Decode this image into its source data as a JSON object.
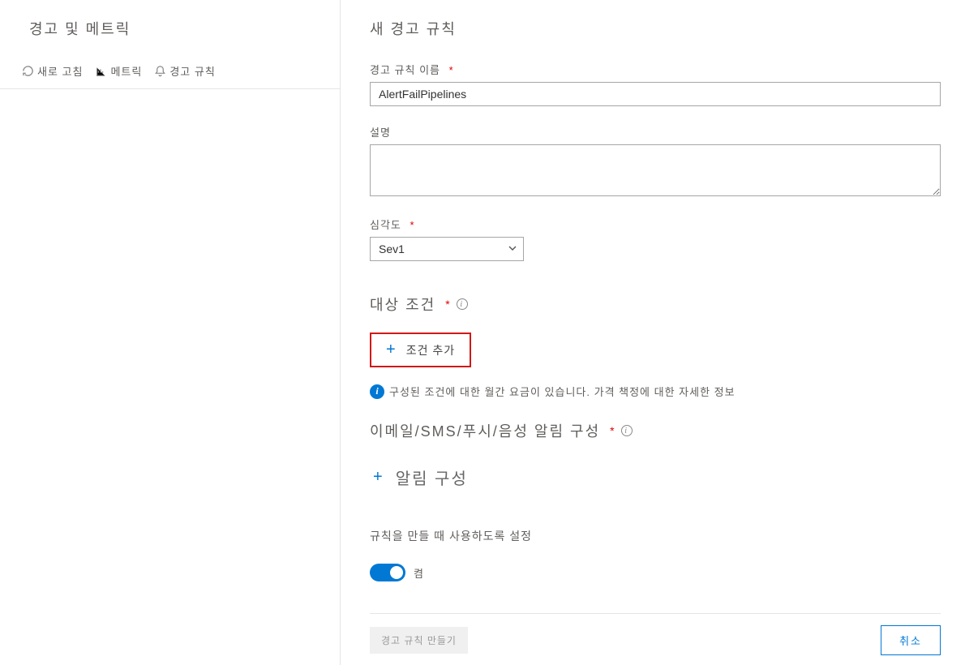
{
  "leftPanel": {
    "title": "경고 및 메트릭",
    "toolbar": {
      "refresh": "새로 고침",
      "metrics": "메트릭",
      "alertRules": "경고 규칙"
    }
  },
  "rightPanel": {
    "title": "새 경고 규칙",
    "ruleName": {
      "label": "경고 규칙 이름",
      "value": "AlertFailPipelines"
    },
    "description": {
      "label": "설명",
      "value": ""
    },
    "severity": {
      "label": "심각도",
      "value": "Sev1"
    },
    "targetCondition": {
      "title": "대상 조건",
      "addButton": "조건 추가",
      "infoText": "구성된 조건에 대한 월간 요금이 있습니다. 가격 책정에 대한 자세한 정보"
    },
    "notification": {
      "title": "이메일/SMS/푸시/음성 알림 구성",
      "addButton": "알림 구성"
    },
    "enableOnCreate": {
      "label": "규칙을 만들 때 사용하도록 설정",
      "toggleLabel": "켬"
    },
    "buttons": {
      "create": "경고 규칙 만들기",
      "cancel": "취소"
    }
  }
}
